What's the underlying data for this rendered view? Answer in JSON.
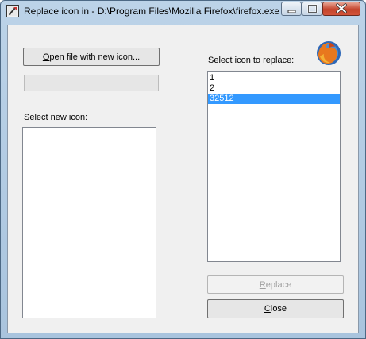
{
  "window": {
    "title": "Replace icon in - D:\\Program Files\\Mozilla Firefox\\firefox.exe"
  },
  "left_panel": {
    "open_button": {
      "before": "",
      "mnemonic": "O",
      "after": "pen file with new icon..."
    },
    "new_icon_label": {
      "before": "Select ",
      "mnemonic": "n",
      "after": "ew icon:"
    },
    "progress": 0
  },
  "right_panel": {
    "select_label": {
      "before": "Select icon to repl",
      "mnemonic": "a",
      "after": "ce:"
    },
    "icons": [
      {
        "label": "1",
        "selected": false
      },
      {
        "label": "2",
        "selected": false
      },
      {
        "label": "32512",
        "selected": true
      }
    ],
    "replace_button": {
      "before": "",
      "mnemonic": "R",
      "after": "eplace",
      "enabled": false
    },
    "close_button": {
      "before": "",
      "mnemonic": "C",
      "after": "lose"
    }
  },
  "colors": {
    "selection": "#3399ff",
    "caption_close": "#c4442c"
  }
}
